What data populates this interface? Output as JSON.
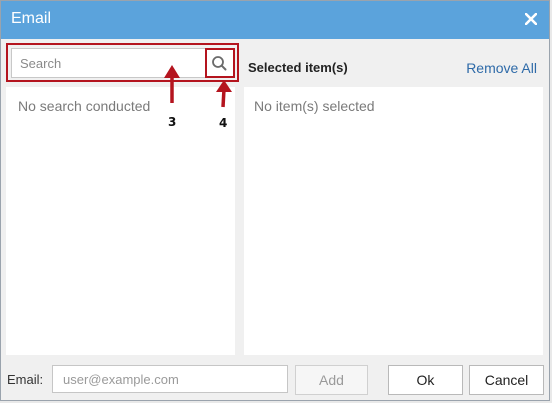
{
  "dialog": {
    "title": "Email",
    "close_icon": "close-icon"
  },
  "search": {
    "placeholder": "Search",
    "value": "",
    "icon": "search-icon"
  },
  "left_panel": {
    "empty_text": "No search conducted"
  },
  "right_panel": {
    "title": "Selected item(s)",
    "remove_all_label": "Remove All",
    "empty_text": "No item(s) selected"
  },
  "annotations": {
    "label_3": "3",
    "label_4": "4",
    "color": "#b4141e"
  },
  "footer": {
    "email_label": "Email:",
    "email_placeholder": "user@example.com",
    "email_value": "",
    "add_label": "Add",
    "ok_label": "Ok",
    "cancel_label": "Cancel"
  },
  "colors": {
    "titlebar": "#5ba3dc",
    "link": "#2e6aa8"
  }
}
